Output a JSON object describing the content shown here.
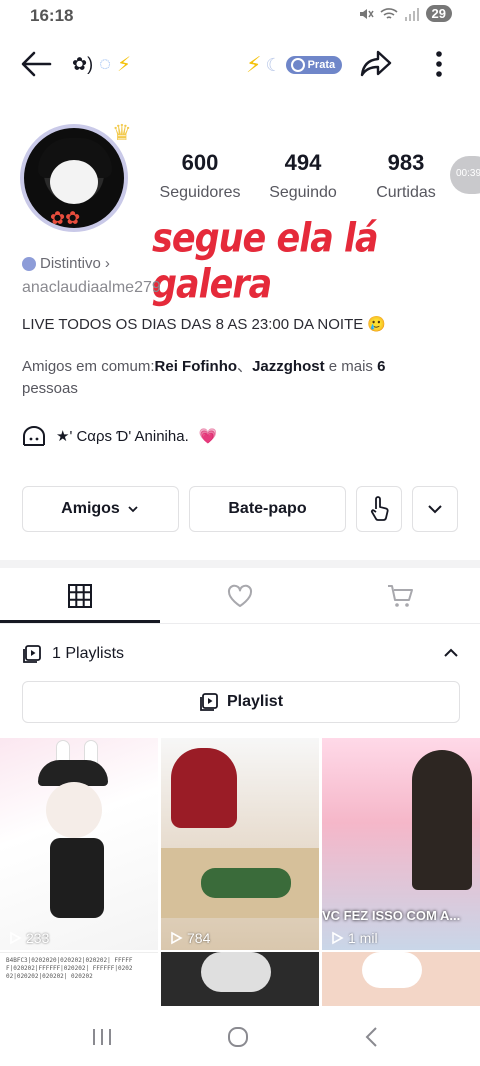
{
  "status_bar": {
    "time": "16:18",
    "battery": "29"
  },
  "header": {
    "title_symbols": "✿)",
    "badge_label": "Prata"
  },
  "profile": {
    "stats": [
      {
        "value": "600",
        "label": "Seguidores"
      },
      {
        "value": "494",
        "label": "Seguindo"
      },
      {
        "value": "983",
        "label": "Curtidas"
      }
    ],
    "overlay_caption": "segue ela lá galera",
    "timer": "00:39",
    "distintivo_label": "Distintivo",
    "username": "anaclaudiaalme279",
    "bio": "LIVE TODOS OS DIAS DAS 8 AS 23:00 DA NOITE 🥲",
    "mutual": {
      "prefix": "Amigos em comum:",
      "friend1": "Rei Fofinho",
      "separator": "、",
      "friend2": "Jazzghost",
      "middle": " e mais ",
      "count": "6",
      "suffix": "pessoas"
    },
    "link_text": "★' Cαρs Ɗ' Aniniha.",
    "link_emoji": "💗"
  },
  "actions": {
    "friends_label": "Amigos",
    "chat_label": "Bate-papo"
  },
  "tabs": [
    {
      "icon": "grid-icon",
      "active": true
    },
    {
      "icon": "heart-icon",
      "active": false
    },
    {
      "icon": "cart-icon",
      "active": false
    }
  ],
  "playlists": {
    "header": "1 Playlists",
    "button_label": "Playlist"
  },
  "videos": [
    {
      "views": "233"
    },
    {
      "views": "784"
    },
    {
      "views": "1 mil",
      "caption": "VC FEZ ISSO COM A..."
    },
    {
      "text": "B4BFC3|0202020|020202|020202| FFFFFF|020202|FFFFFF|020202| FFFFFF|020202|020202|020202| 020202"
    }
  ],
  "colors": {
    "accent_red": "#e52a3a",
    "badge_blue": "#6f86c9",
    "text_primary": "#161823"
  }
}
